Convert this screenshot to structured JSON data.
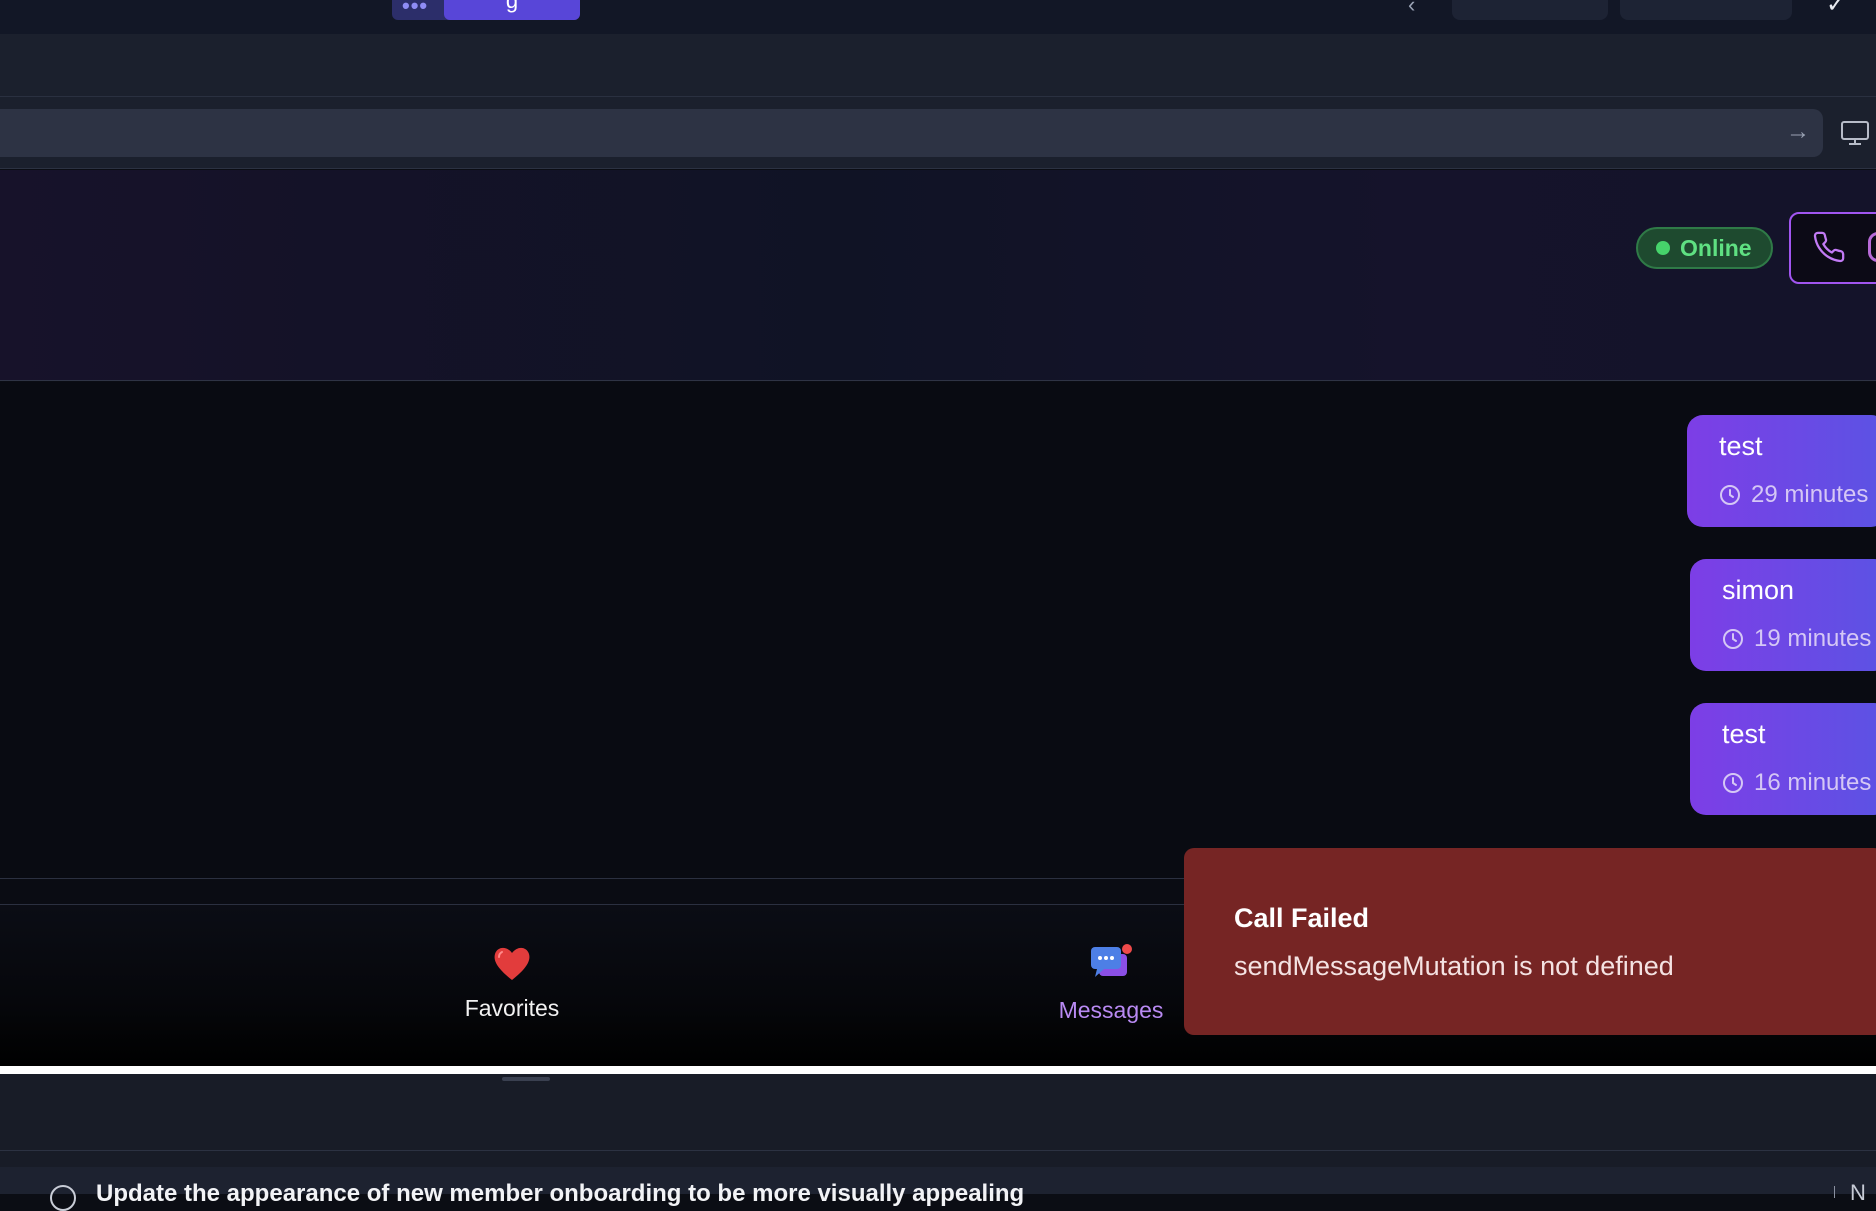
{
  "topbar": {
    "active_tab_label": "g",
    "dots": "•••",
    "chevron": "‹",
    "right_glyph": "✓"
  },
  "urlbar": {
    "go_arrow": "→"
  },
  "chat_header": {
    "status": "Online",
    "status_color": "#5fe082",
    "accent": "#a155f0"
  },
  "messages": [
    {
      "text": "test",
      "time": "29 minutes"
    },
    {
      "text": "simon",
      "time": "19 minutes"
    },
    {
      "text": "test",
      "time": "16 minutes"
    }
  ],
  "bottom_nav": {
    "favorites_label": "Favorites",
    "favorites_icon": "heart-icon",
    "messages_label": "Messages",
    "messages_icon": "chat-bubbles-icon"
  },
  "toast": {
    "title": "Call Failed",
    "message": "sendMessageMutation is not defined",
    "color": "#762524"
  },
  "footer": {
    "task_text": "Update the appearance of new member onboarding to be more visually appealing",
    "right_text": "N"
  }
}
